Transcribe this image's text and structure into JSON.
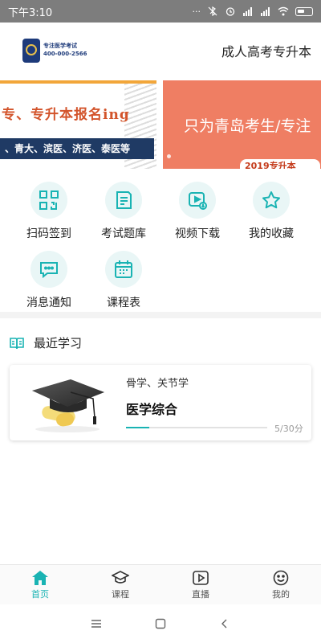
{
  "status_bar": {
    "time": "下午3:10",
    "icons": [
      "more-icon",
      "bluetooth-off-icon",
      "alarm-icon",
      "signal-hd-icon",
      "signal-icon",
      "wifi-icon",
      "battery-icon"
    ]
  },
  "header": {
    "logo_line1": "专注医学考试",
    "logo_line2": "400-000-2566",
    "title": "成人高考专升本"
  },
  "banner": {
    "left_line1": "专、专升本报名ing",
    "left_line2": "、青大、滨医、济医、泰医等",
    "right_text": "只为青岛考生/专注",
    "right_sub": "2019专升本"
  },
  "menu": [
    {
      "label": "扫码签到",
      "icon": "qr-scan-icon"
    },
    {
      "label": "考试题库",
      "icon": "exam-paper-icon"
    },
    {
      "label": "视频下载",
      "icon": "video-download-icon"
    },
    {
      "label": "我的收藏",
      "icon": "star-icon"
    },
    {
      "label": "消息通知",
      "icon": "message-icon"
    },
    {
      "label": "课程表",
      "icon": "calendar-icon"
    }
  ],
  "recent": {
    "title": "最近学习",
    "card": {
      "subtitle": "骨学、关节学",
      "course": "医学综合",
      "progress": "5/30分",
      "progress_fraction": 0.167
    }
  },
  "bottom_nav": [
    {
      "label": "首页",
      "icon": "home-icon",
      "active": true
    },
    {
      "label": "课程",
      "icon": "graduation-cap-icon",
      "active": false
    },
    {
      "label": "直播",
      "icon": "play-icon",
      "active": false
    },
    {
      "label": "我的",
      "icon": "smile-icon",
      "active": false
    }
  ],
  "colors": {
    "accent": "#19b3b3",
    "icon_bg": "#e9f6f6",
    "status_bar": "#7d7d7d"
  }
}
